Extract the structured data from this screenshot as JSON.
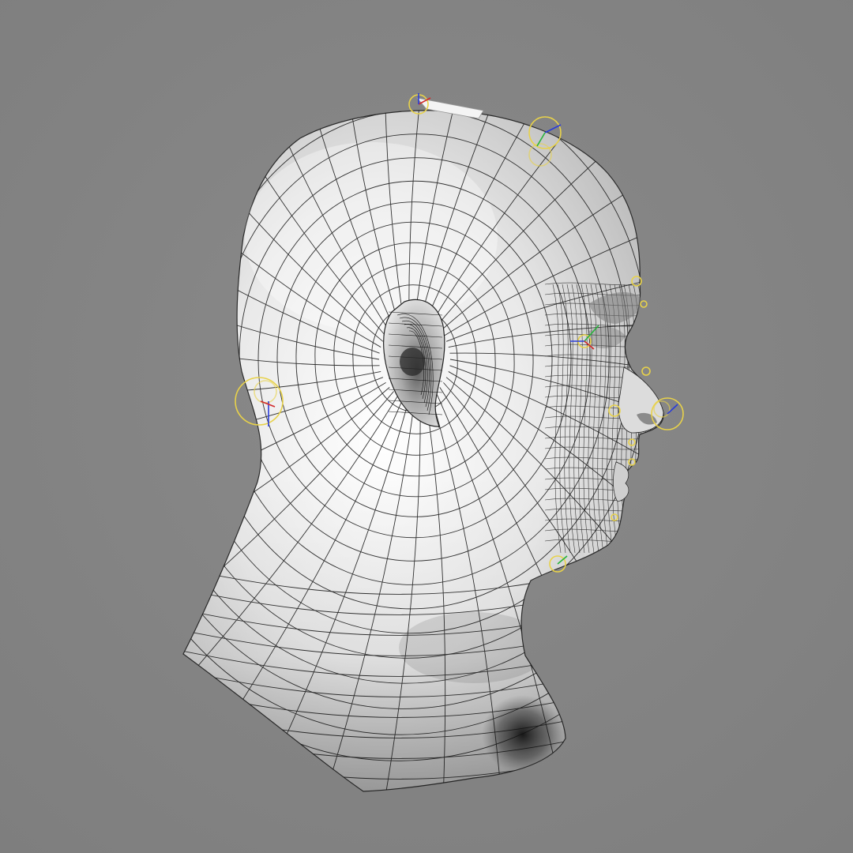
{
  "viewport": {
    "background": "#7e7e7e",
    "background_light": "#8a8a8a",
    "subject": "head-bust-wireframe"
  },
  "mesh": {
    "surface_color": "#e6e6e6",
    "shadow_color": "#1c1c1c",
    "wire_color": "#111111",
    "cage_color": "#f4f4f4"
  },
  "rig": {
    "control_color": "#e8d24a",
    "axis_red": "#d22a2a",
    "axis_green": "#27b43c",
    "axis_blue": "#2a3cd8",
    "controls": [
      "crown-control",
      "top-control",
      "back-head-control",
      "brow-control",
      "eye-control",
      "nose-tip-control",
      "nostril-control",
      "lip-control",
      "jaw-control"
    ]
  }
}
